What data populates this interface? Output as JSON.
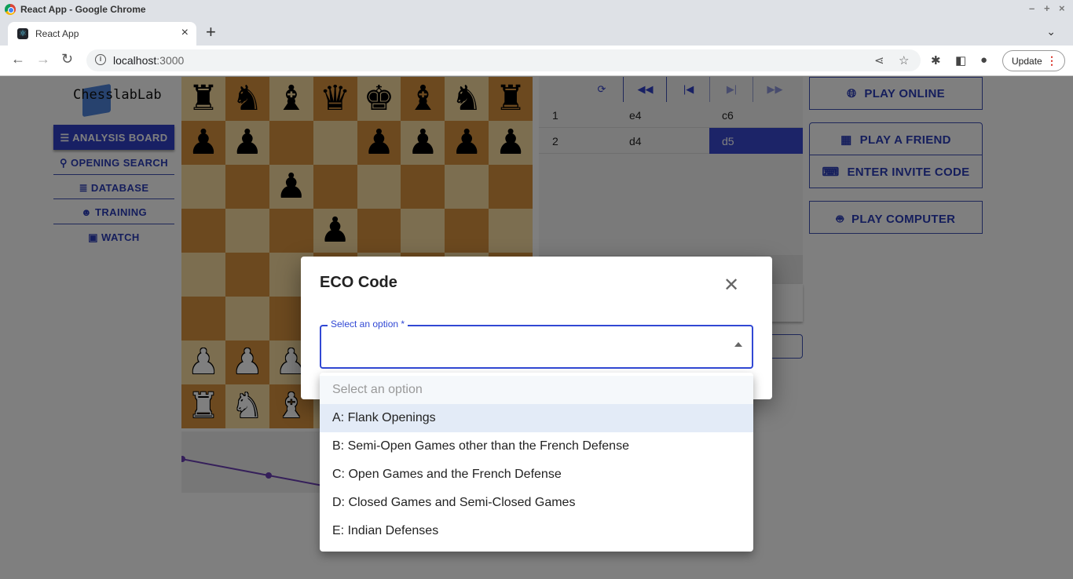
{
  "browser": {
    "window_title": "React App - Google Chrome",
    "tab_title": "React App",
    "url_host": "localhost",
    "url_port": ":3000",
    "update_label": "Update"
  },
  "app": {
    "logo_text": "ChesslabLab",
    "sidebar": [
      {
        "label": "ANALYSIS BOARD",
        "icon": "tune-icon",
        "active": true
      },
      {
        "label": "OPENING SEARCH",
        "icon": "search-icon"
      },
      {
        "label": "DATABASE",
        "icon": "list-icon"
      },
      {
        "label": "TRAINING",
        "icon": "psychology-icon"
      },
      {
        "label": "WATCH",
        "icon": "tv-play-icon"
      }
    ],
    "board": [
      "rnbqkbnr",
      "pp..pppp",
      "..p.....",
      "...p....",
      "...PP...",
      "........",
      "PPP..PPP",
      "RNBQKBNR"
    ],
    "moves": [
      {
        "n": "1",
        "white": "e4",
        "black": "c6"
      },
      {
        "n": "2",
        "white": "d4",
        "black": "d5",
        "selected": "black"
      }
    ],
    "move_controls": [
      "flip-icon",
      "first-icon",
      "prev-icon",
      "next-icon",
      "last-icon"
    ],
    "actions": {
      "play_online": "PLAY ONLINE",
      "play_friend": "PLAY A FRIEND",
      "invite_code": "ENTER INVITE CODE",
      "play_computer": "PLAY COMPUTER"
    }
  },
  "modal": {
    "title": "ECO Code",
    "select_label": "Select an option *",
    "placeholder": "Select an option",
    "options": [
      "A: Flank Openings",
      "B: Semi-Open Games other than the French Defense",
      "C: Open Games and the French Defense",
      "D: Closed Games and Semi-Closed Games",
      "E: Indian Defenses"
    ],
    "highlighted": "A: Flank Openings"
  },
  "colors": {
    "primary": "#3148d4",
    "overlay": "rgba(0,0,0,0.5)"
  }
}
